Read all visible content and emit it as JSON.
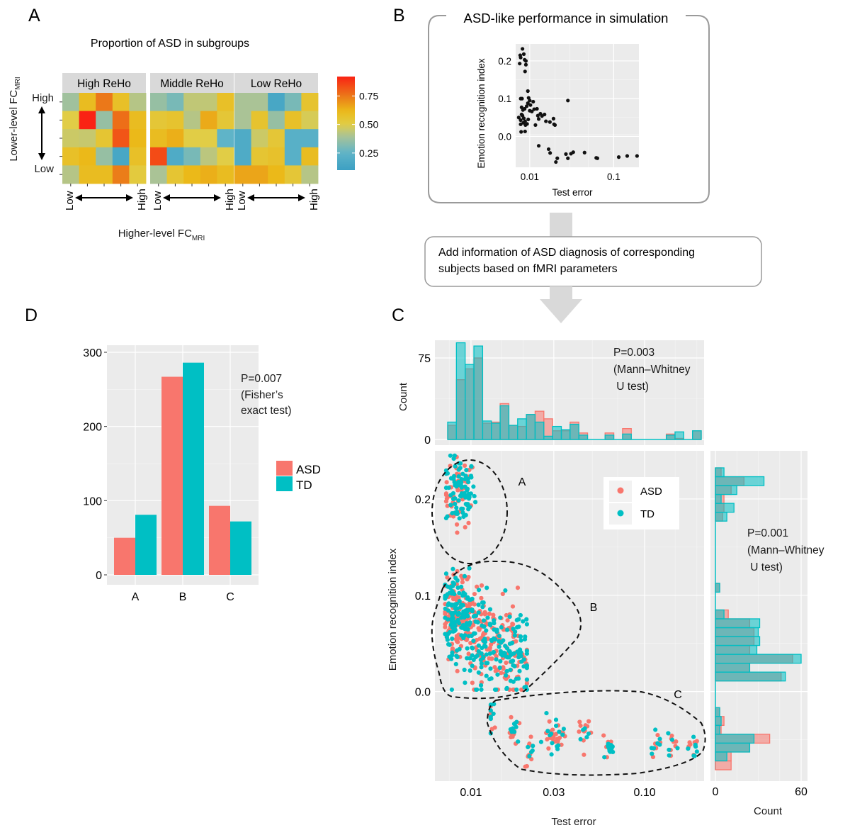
{
  "figure": {
    "panel_letters": {
      "A": "A",
      "B": "B",
      "C": "C",
      "D": "D"
    },
    "flow_box_text": [
      "Add information of ASD diagnosis of corresponding",
      "subjects based on fMRI parameters"
    ],
    "colors": {
      "asd": "#f8766d",
      "td": "#00bfc4",
      "pvalue": "#ff0000",
      "panel_bg": "#ebebeb",
      "strip_bg": "#d9d9d9",
      "arrow_gray": "#d9d9d9"
    }
  },
  "chart_data": [
    {
      "id": "A",
      "type": "heatmap",
      "title": "Proportion of ASD in subgroups",
      "facets": [
        "High ReHo",
        "Middle ReHo",
        "Low ReHo"
      ],
      "xlabel": "Higher-level FC",
      "xlabel_sub": "MRI",
      "ylabel": "Lower-level FC",
      "ylabel_sub": "MRI",
      "x_end_labels": [
        "Low",
        "High"
      ],
      "y_end_labels": [
        "High",
        "Low"
      ],
      "colorbar": {
        "ticks": [
          0.25,
          0.5,
          0.75
        ],
        "tick_labels": [
          "0.25",
          "0.50",
          "0.75"
        ],
        "range": [
          0.1,
          0.92
        ]
      },
      "rows_top_to_bottom": true,
      "values": [
        [
          [
            0.38,
            0.6,
            0.75,
            0.58,
            0.42
          ],
          [
            0.5,
            0.92,
            0.36,
            0.77,
            0.6
          ],
          [
            0.46,
            0.45,
            0.55,
            0.82,
            0.62
          ],
          [
            0.58,
            0.62,
            0.36,
            0.15,
            0.58
          ],
          [
            0.42,
            0.6,
            0.6,
            0.74,
            0.52
          ]
        ],
        [
          [
            0.36,
            0.3,
            0.44,
            0.44,
            0.58
          ],
          [
            0.54,
            0.56,
            0.42,
            0.65,
            0.54
          ],
          [
            0.6,
            0.64,
            0.5,
            0.5,
            0.25
          ],
          [
            0.84,
            0.18,
            0.3,
            0.43,
            0.5
          ],
          [
            0.4,
            0.55,
            0.62,
            0.64,
            0.6
          ]
        ],
        [
          [
            0.4,
            0.4,
            0.15,
            0.3,
            0.56
          ],
          [
            0.4,
            0.56,
            0.36,
            0.58,
            0.48
          ],
          [
            0.18,
            0.46,
            0.54,
            0.22,
            0.22
          ],
          [
            0.18,
            0.55,
            0.57,
            0.22,
            0.6
          ],
          [
            0.66,
            0.66,
            0.62,
            0.54,
            0.42
          ]
        ]
      ]
    },
    {
      "id": "B",
      "type": "scatter",
      "box_title": "ASD-like performance in simulation",
      "xlabel": "Test error",
      "ylabel": "Emotion recognition index",
      "x_scale": "log10",
      "xlim": [
        0.0068,
        0.2
      ],
      "ylim": [
        -0.082,
        0.245
      ],
      "x_ticks": [
        0.01,
        0.1
      ],
      "x_tick_labels": [
        "0.01",
        "0.1"
      ],
      "y_ticks": [
        0.0,
        0.1,
        0.2
      ],
      "y_tick_labels": [
        "0.0",
        "0.1",
        "0.2"
      ],
      "points": [
        [
          0.0082,
          0.232
        ],
        [
          0.0077,
          0.215
        ],
        [
          0.0078,
          0.209
        ],
        [
          0.0085,
          0.218
        ],
        [
          0.0087,
          0.203
        ],
        [
          0.009,
          0.2
        ],
        [
          0.0076,
          0.193
        ],
        [
          0.009,
          0.19
        ],
        [
          0.0088,
          0.172
        ],
        [
          0.0095,
          0.12
        ],
        [
          0.0081,
          0.1
        ],
        [
          0.0078,
          0.1
        ],
        [
          0.0097,
          0.102
        ],
        [
          0.01,
          0.095
        ],
        [
          0.0095,
          0.088
        ],
        [
          0.0102,
          0.083
        ],
        [
          0.0092,
          0.08
        ],
        [
          0.008,
          0.077
        ],
        [
          0.0087,
          0.073
        ],
        [
          0.011,
          0.092
        ],
        [
          0.0083,
          0.07
        ],
        [
          0.01,
          0.068
        ],
        [
          0.0106,
          0.066
        ],
        [
          0.0122,
          0.073
        ],
        [
          0.0113,
          0.072
        ],
        [
          0.0074,
          0.05
        ],
        [
          0.0078,
          0.043
        ],
        [
          0.0082,
          0.055
        ],
        [
          0.0085,
          0.048
        ],
        [
          0.0088,
          0.04
        ],
        [
          0.008,
          0.058
        ],
        [
          0.0084,
          0.036
        ],
        [
          0.0089,
          0.03
        ],
        [
          0.0093,
          0.033
        ],
        [
          0.0096,
          0.045
        ],
        [
          0.0078,
          0.032
        ],
        [
          0.0117,
          0.03
        ],
        [
          0.0125,
          0.055
        ],
        [
          0.0128,
          0.046
        ],
        [
          0.0134,
          0.06
        ],
        [
          0.014,
          0.054
        ],
        [
          0.015,
          0.058
        ],
        [
          0.0156,
          0.04
        ],
        [
          0.0174,
          0.038
        ],
        [
          0.0192,
          0.047
        ],
        [
          0.0195,
          0.032
        ],
        [
          0.02,
          0.03
        ],
        [
          0.0079,
          0.012
        ],
        [
          0.0088,
          0.013
        ],
        [
          0.0285,
          0.095
        ],
        [
          0.0128,
          -0.025
        ],
        [
          0.0168,
          -0.034
        ],
        [
          0.0175,
          -0.044
        ],
        [
          0.0213,
          -0.058
        ],
        [
          0.0205,
          -0.068
        ],
        [
          0.027,
          -0.047
        ],
        [
          0.0285,
          -0.058
        ],
        [
          0.031,
          -0.046
        ],
        [
          0.033,
          -0.042
        ],
        [
          0.045,
          -0.043
        ],
        [
          0.062,
          -0.057
        ],
        [
          0.064,
          -0.058
        ],
        [
          0.115,
          -0.055
        ],
        [
          0.145,
          -0.052
        ],
        [
          0.19,
          -0.052
        ]
      ]
    },
    {
      "id": "C-top",
      "type": "bar",
      "subtype": "overlaid histogram",
      "ylabel": "Count",
      "y_ticks": [
        0,
        75
      ],
      "y_tick_labels": [
        "0",
        "75"
      ],
      "ylim": [
        0,
        90
      ],
      "annotation_p": "P=0.003",
      "annotation_test": [
        "(Mann–Whitney",
        " U test)"
      ],
      "series": [
        {
          "name": "ASD",
          "values": [
            13,
            55,
            65,
            75,
            15,
            16,
            33,
            13,
            12,
            23,
            26,
            19,
            8,
            8,
            16,
            6,
            0,
            0,
            6,
            0,
            10,
            0,
            0,
            0,
            0,
            5,
            1,
            0,
            8
          ]
        },
        {
          "name": "TD",
          "values": [
            16,
            89,
            69,
            86,
            17,
            15,
            31,
            13,
            19,
            23,
            16,
            3,
            12,
            9,
            14,
            4,
            0,
            0,
            4,
            0,
            5,
            0,
            0,
            0,
            0,
            4,
            7,
            0,
            8
          ]
        }
      ]
    },
    {
      "id": "C-main",
      "type": "scatter",
      "xlabel": "Test error",
      "ylabel": "Emotion recognition index",
      "x_scale": "log10",
      "xlim": [
        0.0062,
        0.22
      ],
      "ylim": [
        -0.093,
        0.25
      ],
      "x_ticks": [
        0.01,
        0.03,
        0.1
      ],
      "x_tick_labels": [
        "0.01",
        "0.03",
        "0.10"
      ],
      "y_ticks": [
        0.0,
        0.1,
        0.2
      ],
      "y_tick_labels": [
        "0.0",
        "0.1",
        "0.2"
      ],
      "legend": {
        "entries": [
          "ASD",
          "TD"
        ],
        "position": "top-right"
      },
      "clusters": [
        {
          "label": "A",
          "x_range": [
            0.0072,
            0.0106
          ],
          "y_range": [
            0.165,
            0.245
          ],
          "n_asd": 50,
          "n_td": 81
        },
        {
          "label": "B",
          "x_range": [
            0.0071,
            0.021
          ],
          "y_range": [
            0.002,
            0.128
          ],
          "n_asd": 267,
          "n_td": 286
        },
        {
          "label": "C",
          "x_range": [
            0.013,
            0.2
          ],
          "y_range": [
            -0.078,
            -0.013
          ],
          "n_asd": 93,
          "n_td": 72
        }
      ],
      "cluster_labels": [
        "A",
        "B",
        "C"
      ]
    },
    {
      "id": "C-right",
      "type": "bar",
      "subtype": "overlaid horizontal histogram",
      "xlabel": "Count",
      "x_ticks": [
        0,
        60
      ],
      "x_tick_labels": [
        "0",
        "60"
      ],
      "xlim": [
        -3,
        63
      ],
      "annotation_p": "P=0.001",
      "annotation_test": [
        "(Mann–Whitney",
        " U test)"
      ],
      "bin_centers": [
        0.2375,
        0.2275,
        0.2175,
        0.2075,
        0.1975,
        0.1875,
        0.1775,
        0.1675,
        0.1575,
        0.1475,
        0.1375,
        0.1275,
        0.1175,
        0.1075,
        0.0975,
        0.0875,
        0.0775,
        0.0675,
        0.0575,
        0.0475,
        0.0375,
        0.0275,
        0.0175,
        0.0075,
        -0.0025,
        -0.0125,
        -0.0225,
        -0.0325,
        -0.0425,
        -0.0525,
        -0.0625,
        -0.0725,
        -0.0825
      ],
      "series": [
        {
          "name": "ASD",
          "values": [
            4,
            20,
            11,
            6,
            6,
            5,
            0,
            0,
            0,
            0,
            0,
            0,
            0,
            3,
            0,
            0,
            9,
            24,
            27,
            27,
            24,
            54,
            24,
            46,
            0,
            0,
            0,
            3,
            6,
            4,
            38,
            24,
            11,
            11
          ]
        },
        {
          "name": "TD",
          "values": [
            6,
            34,
            15,
            4,
            13,
            8,
            0,
            0,
            0,
            0,
            0,
            0,
            0,
            3,
            0,
            0,
            6,
            31,
            30,
            31,
            29,
            60,
            24,
            49,
            0,
            0,
            0,
            3,
            4,
            3,
            27,
            24,
            8,
            0
          ]
        }
      ]
    },
    {
      "id": "D",
      "type": "bar",
      "categories": [
        "A",
        "B",
        "C"
      ],
      "series": [
        {
          "name": "ASD",
          "values": [
            50,
            267,
            93
          ]
        },
        {
          "name": "TD",
          "values": [
            81,
            286,
            72
          ]
        }
      ],
      "ylim": [
        0,
        315
      ],
      "y_ticks": [
        0,
        100,
        200,
        300
      ],
      "y_tick_labels": [
        "0",
        "100",
        "200",
        "300"
      ],
      "annotation_p": "P=0.007",
      "annotation_test": [
        "(Fisher’s",
        "exact test)"
      ],
      "legend": {
        "entries": [
          "ASD",
          "TD"
        ],
        "position": "right"
      }
    }
  ]
}
